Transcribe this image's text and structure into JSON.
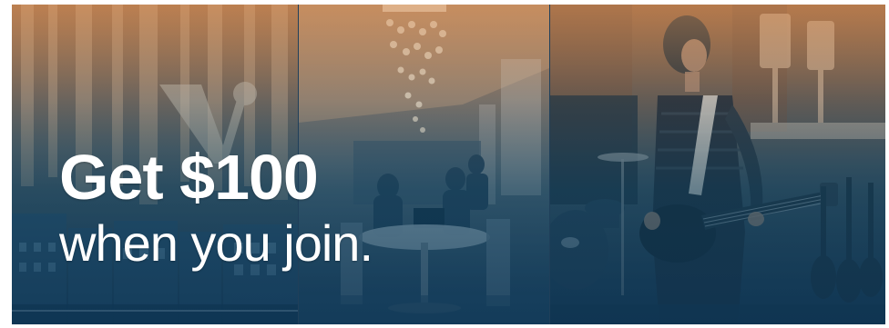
{
  "banner": {
    "headline_bold": "Get $100",
    "headline_light": "when you join.",
    "colors": {
      "overlay_warm": "#d6915a",
      "overlay_cool": "#0e3858",
      "text": "#ffffff"
    },
    "panels": [
      {
        "name": "city-street-photo"
      },
      {
        "name": "lounge-photo"
      },
      {
        "name": "musician-photo"
      }
    ]
  }
}
